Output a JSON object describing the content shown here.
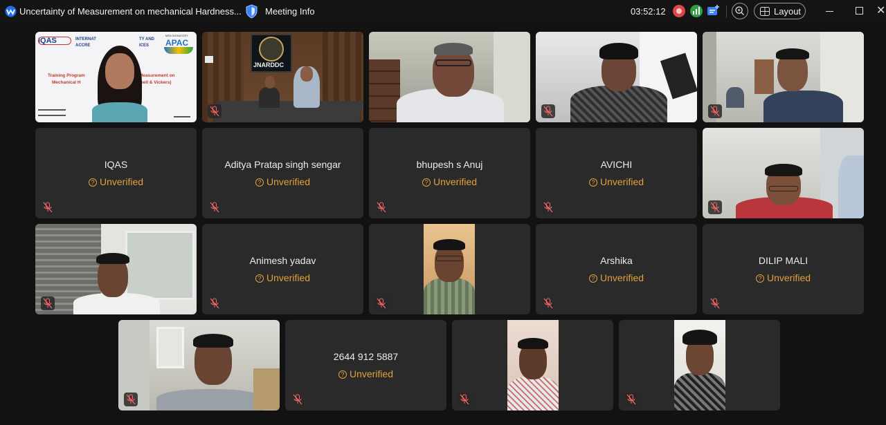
{
  "window": {
    "title": "Uncertainty of Measurement on mechanical Hardness...",
    "meeting_info": "Meeting Info",
    "timer": "03:52:12",
    "layout_label": "Layout",
    "close_glyph": "✕"
  },
  "colors": {
    "background": "#121212",
    "tile": "#2a2a2a",
    "unverified": "#e0a13a",
    "record": "#e0454b",
    "network": "#2ea043",
    "accent": "#3b82f6"
  },
  "unverified_label": "Unverified",
  "slide": {
    "org_left": "IQAS",
    "org_mid_1": "INTERNAT",
    "org_mid_1b": "TY AND",
    "org_mid_2": "ACCRE",
    "org_mid_2b": "ICES",
    "mra": "MRA SIGNATORY",
    "apac": "APAC",
    "line1_a": "Training Program",
    "line1_b": "Measurement on",
    "line2_a": "Mechanical H",
    "line2_b": "inell & Vickers)"
  },
  "room_sign": "JNARDDC",
  "participants": [
    {
      "name": "IQAS",
      "verified": false
    },
    {
      "name": "Aditya Pratap singh sengar",
      "verified": false
    },
    {
      "name": "bhupesh s Anuj",
      "verified": false
    },
    {
      "name": "AVICHI",
      "verified": false
    },
    {
      "name": "Animesh yadav",
      "verified": false
    },
    {
      "name": "Arshika",
      "verified": false
    },
    {
      "name": "DILIP MALI",
      "verified": false
    },
    {
      "name": "2644 912 5887",
      "verified": false
    }
  ]
}
